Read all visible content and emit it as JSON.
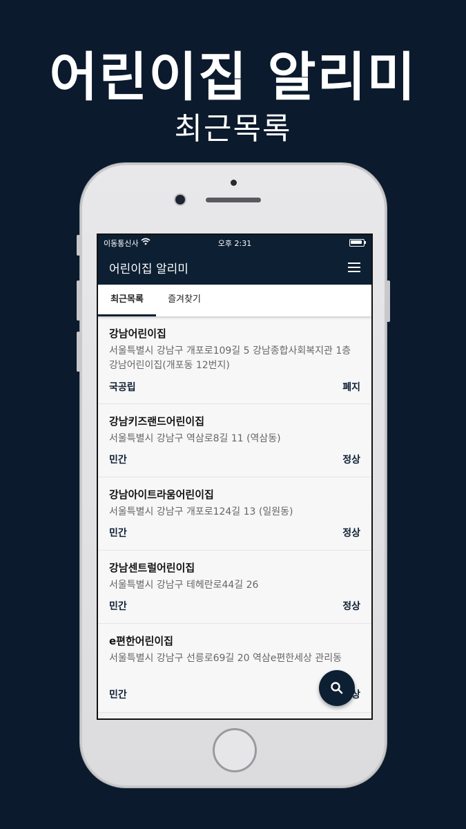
{
  "hero": {
    "title": "어린이집 알리미",
    "subtitle": "최근목록"
  },
  "status_bar": {
    "carrier": "이동통신사",
    "time": "오후 2:31"
  },
  "app_bar": {
    "title": "어린이집 알리미",
    "menu_icon": "hamburger-menu-icon"
  },
  "tabs": [
    {
      "label": "최근목록",
      "active": true
    },
    {
      "label": "즐겨찾기",
      "active": false
    }
  ],
  "items": [
    {
      "name": "강남어린이집",
      "address": "서울특별시 강남구 개포로109길 5 강남종합사회복지관 1층 강남어린이집(개포동 12번지)",
      "type": "국공립",
      "status": "폐지"
    },
    {
      "name": "강남키즈랜드어린이집",
      "address": "서울특별시 강남구 역삼로8길 11 (역삼동)",
      "type": "민간",
      "status": "정상"
    },
    {
      "name": "강남아이트라움어린이집",
      "address": "서울특별시 강남구 개포로124길 13 (일원동)",
      "type": "민간",
      "status": "정상"
    },
    {
      "name": "강남센트럴어린이집",
      "address": "서울특별시 강남구 테헤란로44길 26",
      "type": "민간",
      "status": "정상"
    },
    {
      "name": "e편한어린이집",
      "address": "서울특별시 강남구 선릉로69길 20 역삼e편한세상 관리동",
      "type": "민간",
      "status": "정상"
    }
  ],
  "fab": {
    "icon": "search-icon"
  },
  "colors": {
    "background": "#0b1a2c",
    "primary": "#0d1f33",
    "list_bg": "#f7f7f8"
  }
}
